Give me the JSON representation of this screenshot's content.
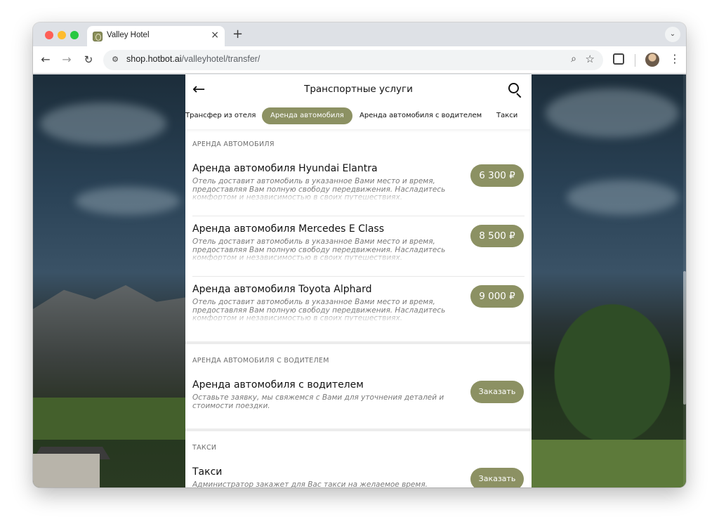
{
  "browser": {
    "tab_title": "Valley Hotel",
    "tab_close": "×",
    "new_tab": "+",
    "tab_menu": "⌄",
    "url_domain": "shop.hotbot.ai",
    "url_path": "/valleyhotel/transfer/"
  },
  "header": {
    "title": "Транспортные услуги",
    "back": "←"
  },
  "tabs": [
    {
      "label": "Трансфер из отеля"
    },
    {
      "label": "Аренда автомобиля",
      "active": true
    },
    {
      "label": "Аренда автомобиля с водителем"
    },
    {
      "label": "Такси"
    }
  ],
  "sections": [
    {
      "label": "АРЕНДА АВТОМОБИЛЯ",
      "items": [
        {
          "title": "Аренда автомобиля Hyundai Elantra",
          "desc": "Отель доставит автомобиль в указанное Вами место и время, предоставляя Вам полную свободу передвижения. Насладитесь комфортом и независимостью в своих путешествиях.",
          "price": "6 300 ₽"
        },
        {
          "title": "Аренда автомобиля Mercedes E Class",
          "desc": "Отель доставит автомобиль в указанное Вами место и время, предоставляя Вам полную свободу передвижения. Насладитесь комфортом и независимостью в своих путешествиях.",
          "price": "8 500 ₽"
        },
        {
          "title": "Аренда автомобиля Toyota Alphard",
          "desc": "Отель доставит автомобиль в указанное Вами место и время, предоставляя Вам полную свободу передвижения. Насладитесь комфортом и независимостью в своих путешествиях.",
          "price": "9 000 ₽"
        }
      ]
    },
    {
      "label": "АРЕНДА АВТОМОБИЛЯ С ВОДИТЕЛЕМ",
      "items": [
        {
          "title": "Аренда автомобиля с водителем",
          "desc": "Оставьте заявку, мы свяжемся с Вами для уточнения деталей и стоимости поездки.",
          "button": "Заказать"
        }
      ]
    },
    {
      "label": "ТАКСИ",
      "items": [
        {
          "title": "Такси",
          "desc": "Администратор закажет для Вас такси на желаемое время.",
          "button": "Заказать"
        }
      ]
    }
  ],
  "colors": {
    "accent": "#8c9163"
  }
}
